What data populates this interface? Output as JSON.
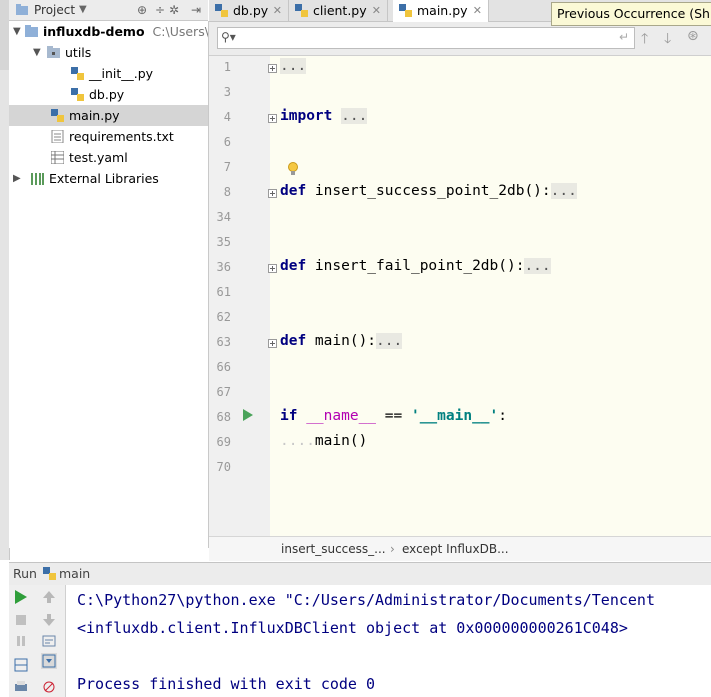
{
  "project_panel": {
    "title": "Project",
    "tree": [
      {
        "label": "influxdb-demo",
        "path": "C:\\Users\\A",
        "bold": true
      },
      {
        "label": "utils"
      },
      {
        "label": "__init__.py"
      },
      {
        "label": "db.py"
      },
      {
        "label": "main.py"
      },
      {
        "label": "requirements.txt"
      },
      {
        "label": "test.yaml"
      },
      {
        "label": "External Libraries"
      }
    ]
  },
  "tabs": [
    {
      "label": "db.py"
    },
    {
      "label": "client.py"
    },
    {
      "label": "main.py",
      "active": true
    }
  ],
  "tooltip": {
    "text": "Previous Occurrence (Shift+"
  },
  "search": {
    "value": ""
  },
  "editor": {
    "lines": [
      {
        "num": "1",
        "tokens": [
          {
            "t": "...",
            "c": "collapsed"
          }
        ]
      },
      {
        "num": "3",
        "tokens": []
      },
      {
        "num": "4",
        "tokens": [
          {
            "t": "import",
            "c": "kw"
          },
          {
            "t": " "
          },
          {
            "t": "...",
            "c": "collapsed"
          }
        ]
      },
      {
        "num": "6",
        "tokens": []
      },
      {
        "num": "7",
        "tokens": []
      },
      {
        "num": "8",
        "tokens": [
          {
            "t": "def",
            "c": "kw"
          },
          {
            "t": " insert_success_point_2db():"
          },
          {
            "t": "...",
            "c": "collapsed"
          }
        ]
      },
      {
        "num": "34",
        "tokens": []
      },
      {
        "num": "35",
        "tokens": []
      },
      {
        "num": "36",
        "tokens": [
          {
            "t": "def",
            "c": "kw"
          },
          {
            "t": " insert_fail_point_2db():"
          },
          {
            "t": "...",
            "c": "collapsed"
          }
        ]
      },
      {
        "num": "61",
        "tokens": []
      },
      {
        "num": "62",
        "tokens": []
      },
      {
        "num": "63",
        "tokens": [
          {
            "t": "def",
            "c": "kw"
          },
          {
            "t": " main():"
          },
          {
            "t": "...",
            "c": "collapsed"
          }
        ]
      },
      {
        "num": "66",
        "tokens": []
      },
      {
        "num": "67",
        "tokens": []
      },
      {
        "num": "68",
        "tokens": [
          {
            "t": "if",
            "c": "kw"
          },
          {
            "t": " "
          },
          {
            "t": "__name__",
            "c": "dunder"
          },
          {
            "t": " == "
          },
          {
            "t": "'__main__'",
            "c": "str"
          },
          {
            "t": ":"
          }
        ]
      },
      {
        "num": "69",
        "tokens": [
          {
            "t": "....",
            "c": "ws"
          },
          {
            "t": "main()"
          }
        ]
      },
      {
        "num": "70",
        "tokens": []
      }
    ]
  },
  "breadcrumb": [
    "insert_success_...",
    "except InfluxDB..."
  ],
  "run_panel": {
    "title": "Run",
    "config": "main",
    "output": [
      "C:\\Python27\\python.exe \"C:/Users/Administrator/Documents/Tencent",
      "<influxdb.client.InfluxDBClient object at 0x000000000261C048>",
      "",
      "Process finished with exit code 0"
    ]
  },
  "colors": {
    "keyword": "#000080",
    "string": "#008080",
    "dunder": "#b200b2",
    "editor_bg": "#fdfdf1",
    "caret_line": "#f1ebd5",
    "run_green": "#2f9e3a"
  }
}
